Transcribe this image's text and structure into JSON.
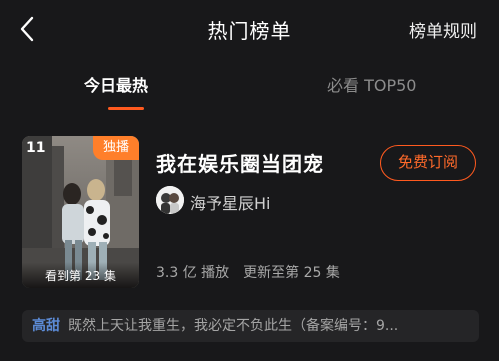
{
  "header": {
    "title": "热门榜单",
    "rules_label": "榜单规则"
  },
  "tabs": [
    {
      "label": "今日最热",
      "active": true
    },
    {
      "label": "必看 TOP50",
      "active": false
    }
  ],
  "book": {
    "rank": "11",
    "badge": "独播",
    "watched": "看到第 23 集",
    "title": "我在娱乐圈当团宠",
    "subscribe_label": "免费订阅",
    "author": "海予星辰Hi",
    "plays": "3.3 亿 播放",
    "updated": "更新至第 25 集",
    "tag": "高甜",
    "description": "既然上天让我重生，我必定不负此生（备案编号：9..."
  },
  "colors": {
    "accent": "#ff5a1f",
    "badge": "#ff7f2a",
    "tag": "#5c8bd6",
    "background": "#18181a"
  }
}
